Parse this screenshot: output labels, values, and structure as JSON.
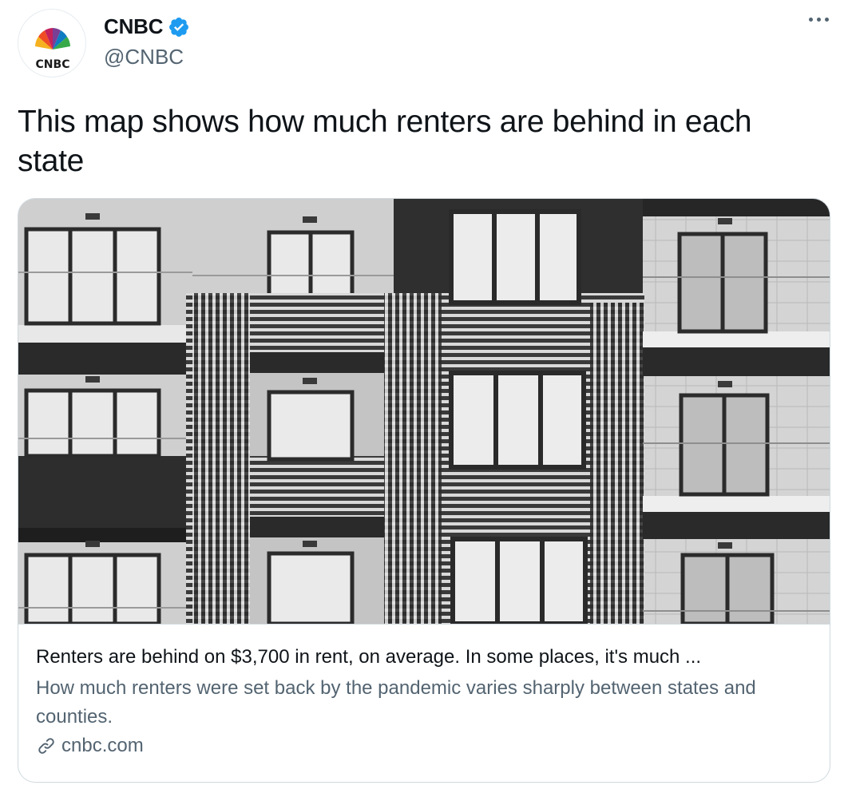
{
  "account": {
    "name": "CNBC",
    "handle": "@CNBC",
    "avatar_logo_text": "CNBC",
    "verified": true
  },
  "icons": {
    "verified": "verified-badge-icon",
    "more": "more-options-icon",
    "link": "link-icon"
  },
  "tweet": {
    "text": "This map shows how much renters are behind in each state"
  },
  "card": {
    "title": "Renters are behind on $3,700 in rent, on average. In some places, it's much ...",
    "description": "How much renters were set back by the pandemic varies sharply between states and counties.",
    "domain": "cnbc.com"
  },
  "colors": {
    "verified_blue": "#1d9bf0",
    "text_primary": "#0f1419",
    "text_secondary": "#536471",
    "border": "#cfd9de"
  }
}
